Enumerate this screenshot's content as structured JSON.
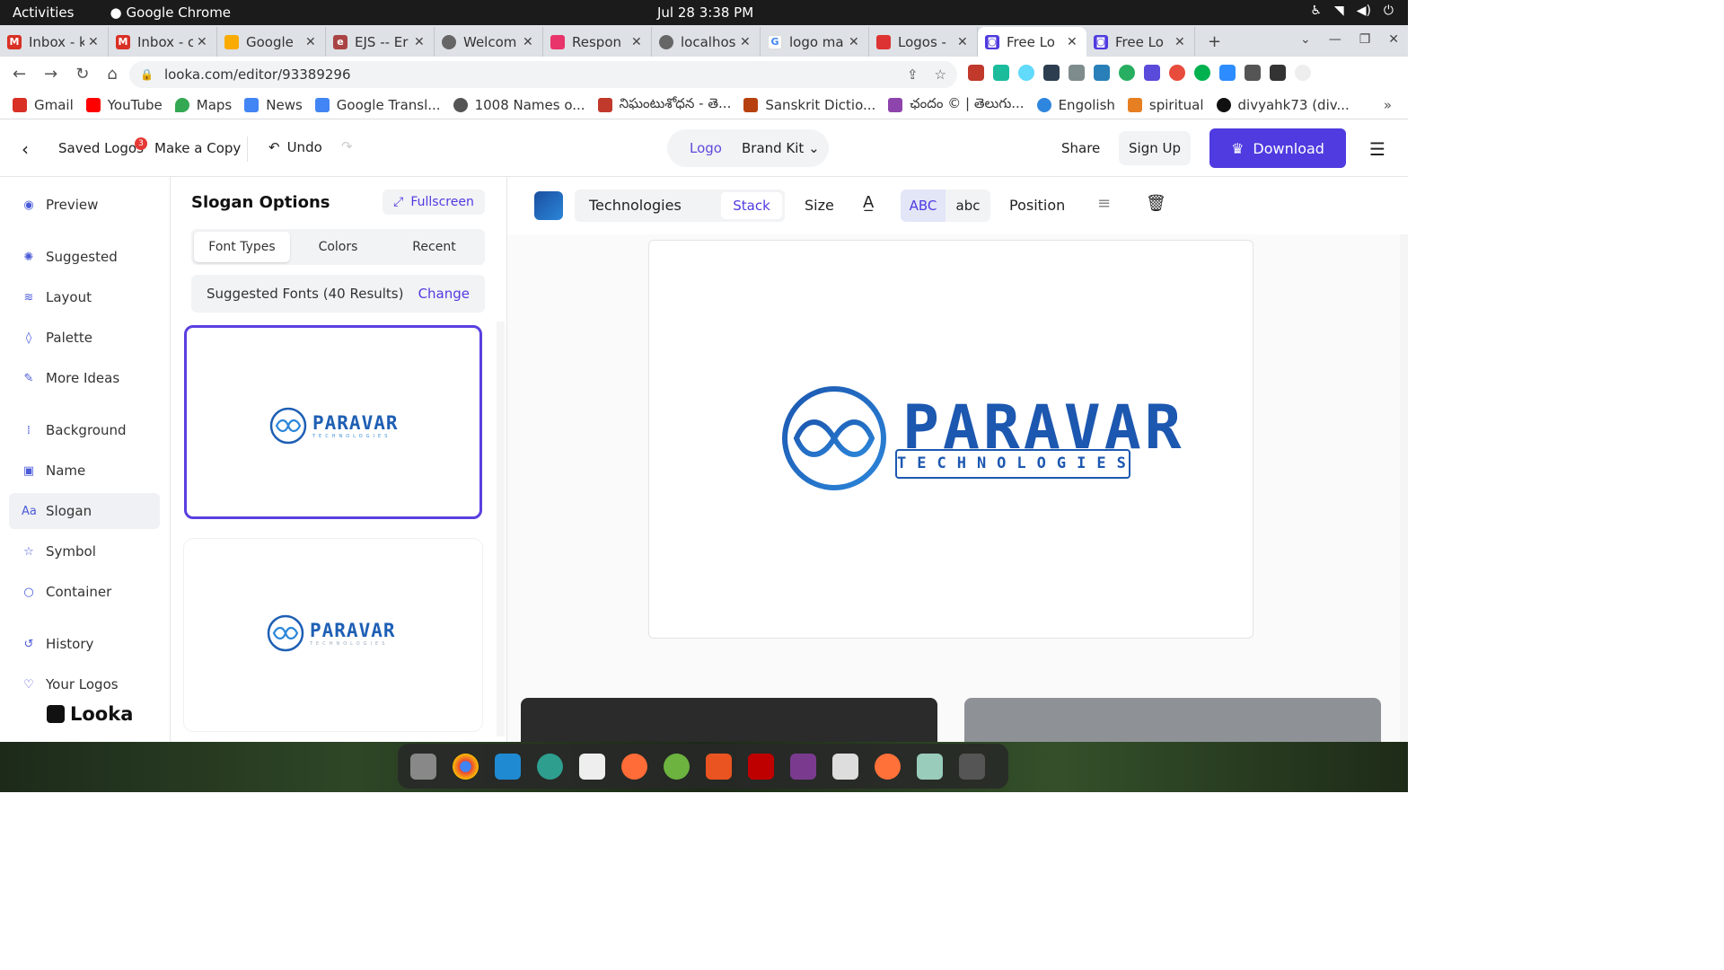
{
  "system": {
    "activities": "Activities",
    "app": "Google Chrome",
    "clock": "Jul 28  3:38 PM"
  },
  "tabs": [
    {
      "title": "Inbox - k",
      "color": "#d93025",
      "icon": "gmail-icon"
    },
    {
      "title": "Inbox - c",
      "color": "#d93025",
      "icon": "gmail-icon"
    },
    {
      "title": "Google",
      "color": "#f9ab00",
      "icon": "keep-icon"
    },
    {
      "title": "EJS -- Er",
      "color": "#a44",
      "icon": "ejs-icon"
    },
    {
      "title": "Welcom",
      "color": "#555",
      "icon": "globe-icon"
    },
    {
      "title": "Respon",
      "color": "#e8336b",
      "icon": "stack-icon"
    },
    {
      "title": "localhos",
      "color": "#555",
      "icon": "globe-icon"
    },
    {
      "title": "logo ma",
      "color": "#4285f4",
      "icon": "google-icon"
    },
    {
      "title": "Logos -",
      "color": "#d33",
      "icon": "brush-icon"
    },
    {
      "title": "Free Lo",
      "color": "#4f3be0",
      "icon": "looka-icon"
    },
    {
      "title": "Free Lo",
      "color": "#4f3be0",
      "icon": "looka-icon"
    }
  ],
  "address": "looka.com/editor/93389296",
  "bookmarks": [
    {
      "label": "Gmail",
      "color": "#d93025"
    },
    {
      "label": "YouTube",
      "color": "#ff0000"
    },
    {
      "label": "Maps",
      "color": "#34a853"
    },
    {
      "label": "News",
      "color": "#4285f4"
    },
    {
      "label": "Google Transl...",
      "color": "#4285f4"
    },
    {
      "label": "1008 Names o...",
      "color": "#555"
    },
    {
      "label": "నిఘంటుశోధన - తె...",
      "color": "#c0392b"
    },
    {
      "label": "Sanskrit Dictio...",
      "color": "#b7410e"
    },
    {
      "label": "ఛందం © | తెలుగు...",
      "color": "#8e44ad"
    },
    {
      "label": "Engolish",
      "color": "#2e86de"
    },
    {
      "label": "spiritual",
      "color": "#e67e22"
    },
    {
      "label": "divyahk73 (div...",
      "color": "#111"
    }
  ],
  "header": {
    "saved_logos": "Saved Logos",
    "saved_count": "3",
    "make_copy": "Make a Copy",
    "undo": "Undo",
    "seg_logo": "Logo",
    "seg_brand": "Brand Kit",
    "share": "Share",
    "signup": "Sign Up",
    "download": "Download"
  },
  "sidebar": [
    {
      "label": "Preview",
      "icon": "eye-icon"
    },
    {
      "label": "Suggested",
      "icon": "lightbulb-icon"
    },
    {
      "label": "Layout",
      "icon": "layers-icon"
    },
    {
      "label": "Palette",
      "icon": "drop-icon"
    },
    {
      "label": "More Ideas",
      "icon": "wand-icon"
    },
    {
      "label": "Background",
      "icon": "grid-icon"
    },
    {
      "label": "Name",
      "icon": "text-box-icon"
    },
    {
      "label": "Slogan",
      "icon": "type-icon"
    },
    {
      "label": "Symbol",
      "icon": "star-icon"
    },
    {
      "label": "Container",
      "icon": "circle-icon"
    },
    {
      "label": "History",
      "icon": "history-icon"
    },
    {
      "label": "Your Logos",
      "icon": "heart-icon"
    }
  ],
  "brand": "Looka",
  "panel": {
    "title": "Slogan Options",
    "fullscreen": "Fullscreen",
    "tabs": [
      "Font Types",
      "Colors",
      "Recent"
    ],
    "suggested": "Suggested Fonts (40 Results)",
    "change": "Change",
    "card1_name": "PARAVAR",
    "card1_slogan": "TECHNOLOGIES",
    "card2_name": "PARAVAR",
    "card2_slogan": "TECHNOLOGIES"
  },
  "canvas": {
    "slogan_value": "Technologies",
    "stack": "Stack",
    "size": "Size",
    "case_upper": "ABC",
    "case_lower": "abc",
    "position": "Position",
    "logo_name": "PARAVAR",
    "logo_slogan": "TECHNOLOGIES",
    "brand_colors": [
      "#1c57b0",
      "#2b86d9"
    ]
  }
}
